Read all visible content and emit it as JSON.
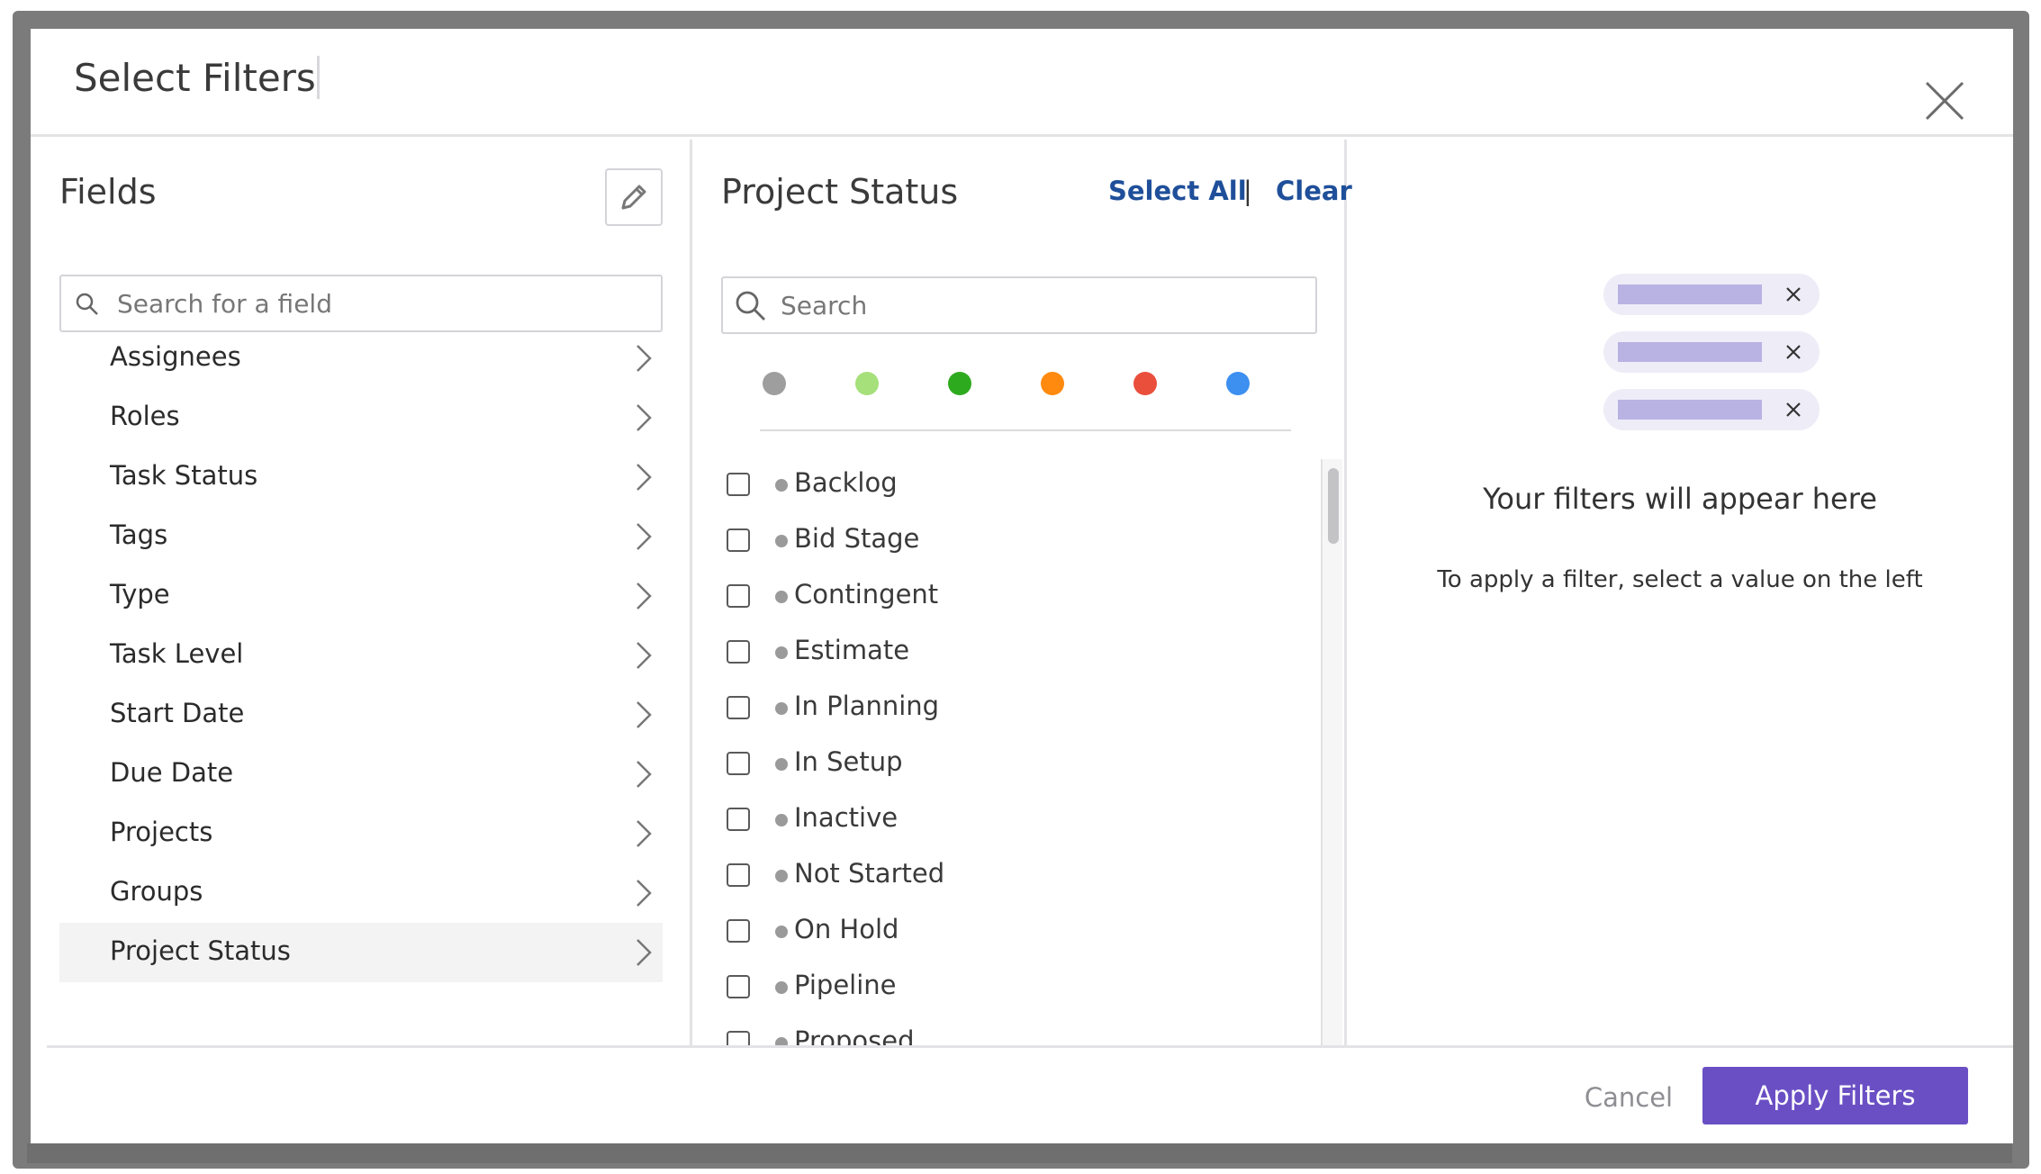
{
  "modal": {
    "title": "Select Filters"
  },
  "fields_panel": {
    "title": "Fields",
    "search_placeholder": "Search for a field",
    "items": [
      {
        "label": "Assignees"
      },
      {
        "label": "Roles"
      },
      {
        "label": "Task Status"
      },
      {
        "label": "Tags"
      },
      {
        "label": "Type"
      },
      {
        "label": "Task Level"
      },
      {
        "label": "Start Date"
      },
      {
        "label": "Due Date"
      },
      {
        "label": "Projects"
      },
      {
        "label": "Groups"
      },
      {
        "label": "Project Status"
      }
    ],
    "active_item": "Project Status"
  },
  "values_panel": {
    "title": "Project Status",
    "select_all_label": "Select All",
    "separator": "|",
    "clear_label": "Clear",
    "search_placeholder": "Search",
    "color_filters": [
      "#9e9e9e",
      "#a6e07a",
      "#2eaa1e",
      "#ff8a0f",
      "#ea4f3c",
      "#3d8ff0"
    ],
    "items": [
      {
        "label": "Backlog",
        "checked": false
      },
      {
        "label": "Bid Stage",
        "checked": false
      },
      {
        "label": "Contingent",
        "checked": false
      },
      {
        "label": "Estimate",
        "checked": false
      },
      {
        "label": "In Planning",
        "checked": false
      },
      {
        "label": "In Setup",
        "checked": false
      },
      {
        "label": "Inactive",
        "checked": false
      },
      {
        "label": "Not Started",
        "checked": false
      },
      {
        "label": "On Hold",
        "checked": false
      },
      {
        "label": "Pipeline",
        "checked": false
      },
      {
        "label": "Proposed",
        "checked": false
      }
    ]
  },
  "selected_panel": {
    "empty_title": "Your filters will appear here",
    "empty_subtitle": "To apply a filter, select a value on the left"
  },
  "footer": {
    "cancel_label": "Cancel",
    "apply_label": "Apply Filters"
  },
  "colors": {
    "accent": "#6a4fc4",
    "link": "#1f4f9a"
  }
}
